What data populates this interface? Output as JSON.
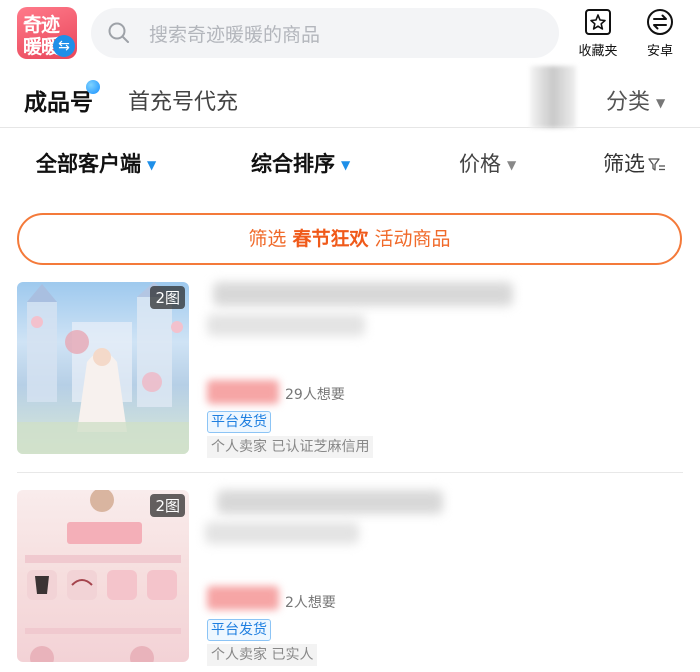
{
  "header": {
    "logo_line1": "奇迹",
    "logo_line2": "暖暖",
    "search_placeholder": "搜索奇迹暖暖的商品",
    "favorites_label": "收藏夹",
    "platform_label": "安卓"
  },
  "tabs": {
    "primary": "成品号",
    "secondary": "首充号代充",
    "category": "分类"
  },
  "sort_bar": {
    "client": "全部客户端",
    "sort": "综合排序",
    "price": "价格",
    "filter": "筛选"
  },
  "banner": {
    "prefix": "筛选",
    "highlight": "春节狂欢",
    "suffix": "活动商品"
  },
  "listings": [
    {
      "pic_count": "2图",
      "wants": "29人想要",
      "shipping_tag": "平台发货",
      "seller_info": "个人卖家  已认证芝麻信用"
    },
    {
      "pic_count": "2图",
      "wants": "2人想要",
      "shipping_tag": "平台发货",
      "seller_info": "个人卖家  已实人"
    }
  ],
  "colors": {
    "accent_blue": "#1e8fe8",
    "banner_orange": "#f06a2a"
  }
}
